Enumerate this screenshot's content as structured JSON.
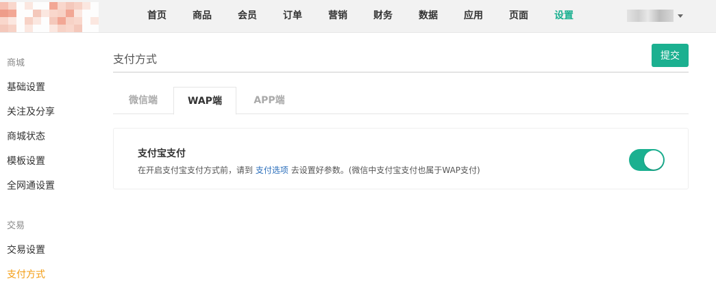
{
  "header": {
    "nav": [
      {
        "label": "首页",
        "active": false
      },
      {
        "label": "商品",
        "active": false
      },
      {
        "label": "会员",
        "active": false
      },
      {
        "label": "订单",
        "active": false
      },
      {
        "label": "营销",
        "active": false
      },
      {
        "label": "财务",
        "active": false
      },
      {
        "label": "数据",
        "active": false
      },
      {
        "label": "应用",
        "active": false
      },
      {
        "label": "页面",
        "active": false
      },
      {
        "label": "设置",
        "active": true
      }
    ]
  },
  "sidebar": {
    "groups": [
      {
        "title": "商城",
        "items": [
          {
            "label": "基础设置",
            "active": false
          },
          {
            "label": "关注及分享",
            "active": false
          },
          {
            "label": "商城状态",
            "active": false
          },
          {
            "label": "模板设置",
            "active": false
          },
          {
            "label": "全网通设置",
            "active": false
          }
        ]
      },
      {
        "title": "交易",
        "items": [
          {
            "label": "交易设置",
            "active": false
          },
          {
            "label": "支付方式",
            "active": true
          }
        ]
      }
    ]
  },
  "main": {
    "title": "支付方式",
    "submit_label": "提交",
    "tabs": [
      {
        "label": "微信端",
        "active": false
      },
      {
        "label": "WAP端",
        "active": true
      },
      {
        "label": "APP端",
        "active": false
      }
    ],
    "payment": {
      "name": "支付宝支付",
      "desc_before": "在开启支付宝支付方式前，请到",
      "desc_link": "支付选项",
      "desc_after": "去设置好参数。(微信中支付宝支付也属于WAP支付)",
      "enabled": true
    }
  },
  "colors": {
    "accent": "#1bb090",
    "active_sidebar": "#f39c12",
    "link": "#2a6ebb"
  }
}
